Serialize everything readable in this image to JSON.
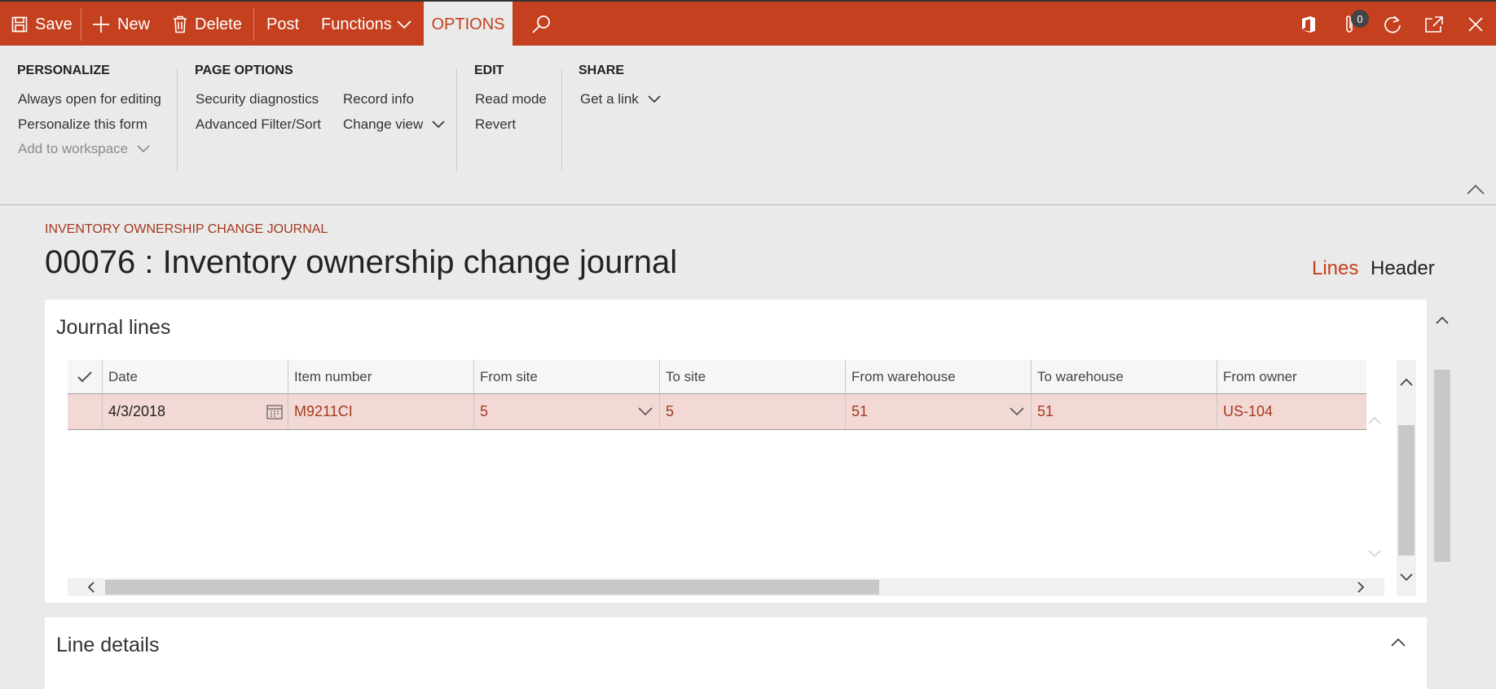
{
  "toolbar": {
    "save_label": "Save",
    "new_label": "New",
    "delete_label": "Delete",
    "post_label": "Post",
    "functions_label": "Functions",
    "options_tab_label": "OPTIONS",
    "attachments_count": "0",
    "accent_color": "#c4401f"
  },
  "ribbon": {
    "personalize": {
      "title": "PERSONALIZE",
      "items": [
        "Always open for editing",
        "Personalize this form",
        "Add to workspace"
      ]
    },
    "page_options": {
      "title": "PAGE OPTIONS",
      "items": [
        "Security diagnostics",
        "Advanced Filter/Sort",
        "Record info",
        "Change view"
      ]
    },
    "edit": {
      "title": "EDIT",
      "items": [
        "Read mode",
        "Revert"
      ]
    },
    "share": {
      "title": "SHARE",
      "items": [
        "Get a link"
      ]
    }
  },
  "page": {
    "breadcrumb": "INVENTORY OWNERSHIP CHANGE JOURNAL",
    "title": "00076 : Inventory ownership change journal",
    "view_tabs": [
      "Lines",
      "Header"
    ]
  },
  "journal_lines": {
    "title": "Journal lines",
    "columns": [
      "Date",
      "Item number",
      "From site",
      "To site",
      "From warehouse",
      "To warehouse",
      "From owner"
    ],
    "rows": [
      [
        "4/3/2018",
        "M9211CI",
        "5",
        "5",
        "51",
        "51",
        "US-104"
      ]
    ]
  },
  "line_details": {
    "title": "Line details"
  }
}
